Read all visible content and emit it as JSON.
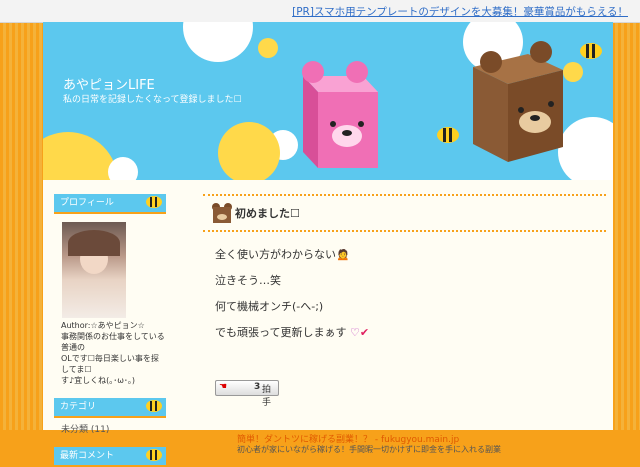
{
  "pr_bar": {
    "link": "[PR]スマホ用テンプレートのデザインを大募集！豪華賞品がもらえる！"
  },
  "header": {
    "title": "あやピョンLIFE",
    "subtitle": "私の日常を記録したくなって登録しました☐"
  },
  "sidebar": {
    "profile": {
      "heading": "プロフィール",
      "author": "Author:☆あやピョン☆",
      "description_lines": [
        "事務関係のお仕事をしている普通の",
        "OLです☐毎日楽しい事を探してま☐",
        "す♪宜しくね(｡･ω･｡)"
      ]
    },
    "category": {
      "heading": "カテゴリ",
      "items": [
        "未分類 (11)"
      ]
    },
    "third_heading": "最新コメント"
  },
  "entry": {
    "title": "初めました☐",
    "lines": [
      "全く使い方がわからない🙍",
      "泣きそう…笑",
      "何て機械オンチ(-へ-;)",
      "でも頑張って更新しまぁす"
    ],
    "clap_count": "3",
    "clap_label": "拍手"
  },
  "ad": {
    "title": "簡単！ダントツに稼げる副業！？ - fukugyou.main.jp",
    "desc": "初心者が家にいながら稼げる！手間暇一切かけずに即金を手に入れる副業"
  },
  "colors": {
    "orange": "#f7a11a",
    "sky": "#5cc8ee",
    "pink": "#f06fb5",
    "brown": "#8a5a35"
  }
}
